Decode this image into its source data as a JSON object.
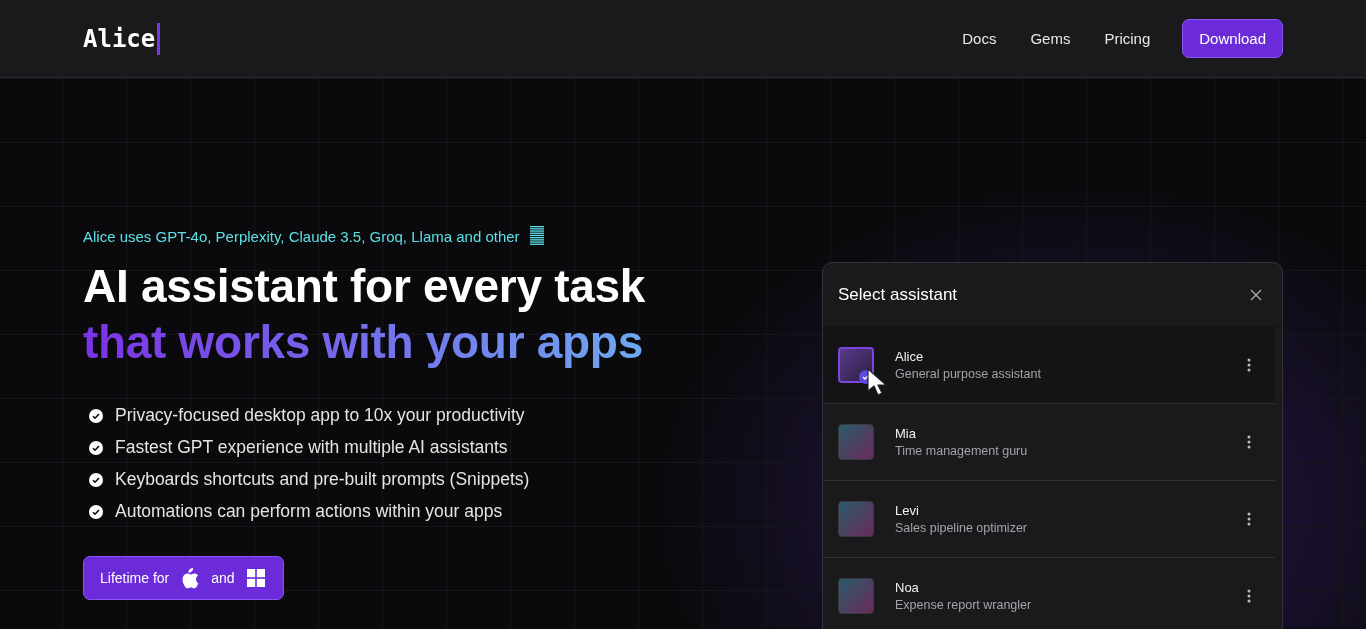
{
  "brand": "Alice",
  "nav": {
    "links": [
      "Docs",
      "Gems",
      "Pricing"
    ],
    "cta": "Download"
  },
  "hero": {
    "tagline": "Alice uses GPT-4o, Perplexity, Claude 3.5, Groq, Llama and other",
    "headline": "AI assistant for every task",
    "headline_accent": "that works with your apps",
    "features": [
      "Privacy-focused desktop app to 10x your productivity",
      "Fastest GPT experience with multiple AI assistants",
      "Keyboards shortcuts and pre-built prompts (Snippets)",
      "Automations can perform actions within your apps"
    ],
    "cta": {
      "prefix": "Lifetime for",
      "joiner": "and"
    }
  },
  "panel": {
    "title": "Select assistant",
    "assistants": [
      {
        "name": "Alice",
        "role": "General purpose assistant",
        "selected": true
      },
      {
        "name": "Mia",
        "role": "Time management guru",
        "selected": false
      },
      {
        "name": "Levi",
        "role": "Sales pipeline optimizer",
        "selected": false
      },
      {
        "name": "Noa",
        "role": "Expense report wrangler",
        "selected": false
      }
    ]
  }
}
